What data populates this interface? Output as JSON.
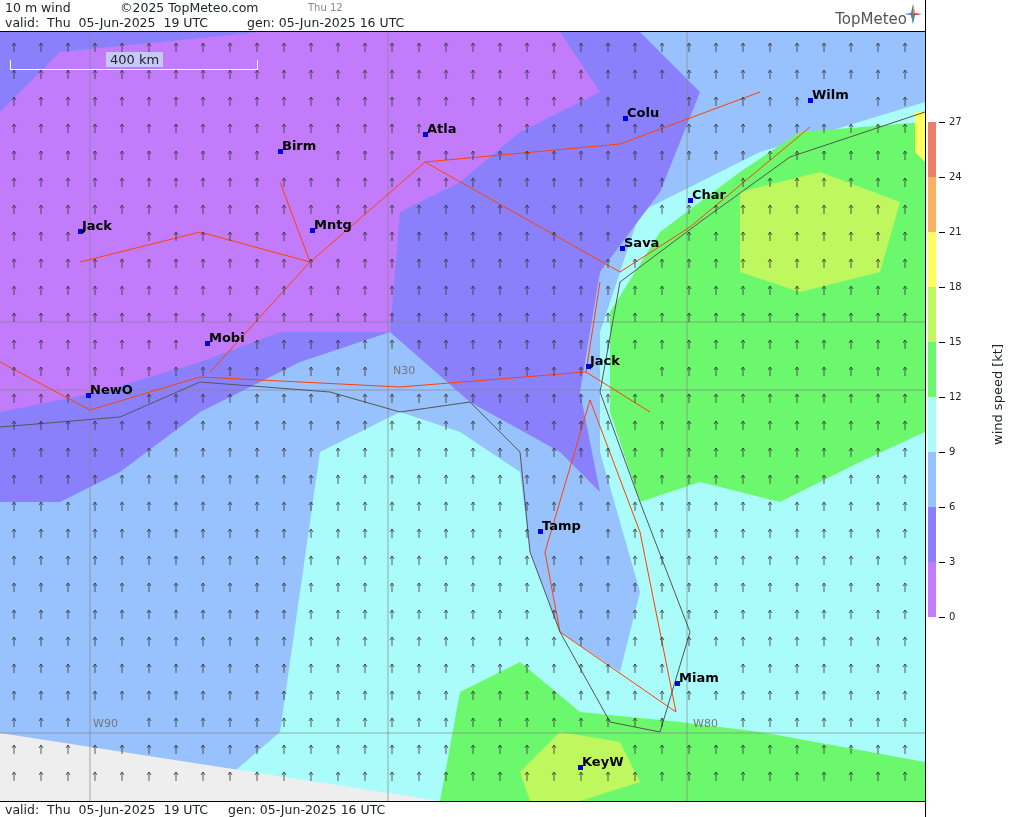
{
  "header": {
    "title": "10 m wind",
    "copyright": "©2025 TopMeteo.com",
    "day_label": "Thu 12",
    "valid": "valid:  Thu  05-Jun-2025  19 UTC",
    "generated": "gen: 05-Jun-2025 16 UTC",
    "logo": "TopMeteo"
  },
  "map": {
    "scale": "400 km",
    "grid_labels": [
      "N30",
      "W90",
      "W80"
    ],
    "cities": [
      "Birm",
      "Atla",
      "Colu",
      "Wilm",
      "Char",
      "Jack",
      "Mntg",
      "Sava",
      "Mobi",
      "NewO",
      "Jack",
      "Tamp",
      "Miam",
      "KeyW"
    ]
  },
  "legend": {
    "title": "wind speed [kt]",
    "ticks": [
      "27",
      "24",
      "21",
      "18",
      "15",
      "12",
      "9",
      "6",
      "3",
      "0"
    ],
    "bins": [
      {
        "color": "#ee7f66"
      },
      {
        "color": "#fbaf62"
      },
      {
        "color": "#fdfd5f"
      },
      {
        "color": "#bff75f"
      },
      {
        "color": "#6cf86c"
      },
      {
        "color": "#aafcfb"
      },
      {
        "color": "#97c2fd"
      },
      {
        "color": "#8b80fb"
      },
      {
        "color": "#c27cfb"
      }
    ]
  },
  "footer": {
    "valid": "valid:  Thu  05-Jun-2025  19 UTC",
    "generated": "gen: 05-Jun-2025 16 UTC"
  }
}
